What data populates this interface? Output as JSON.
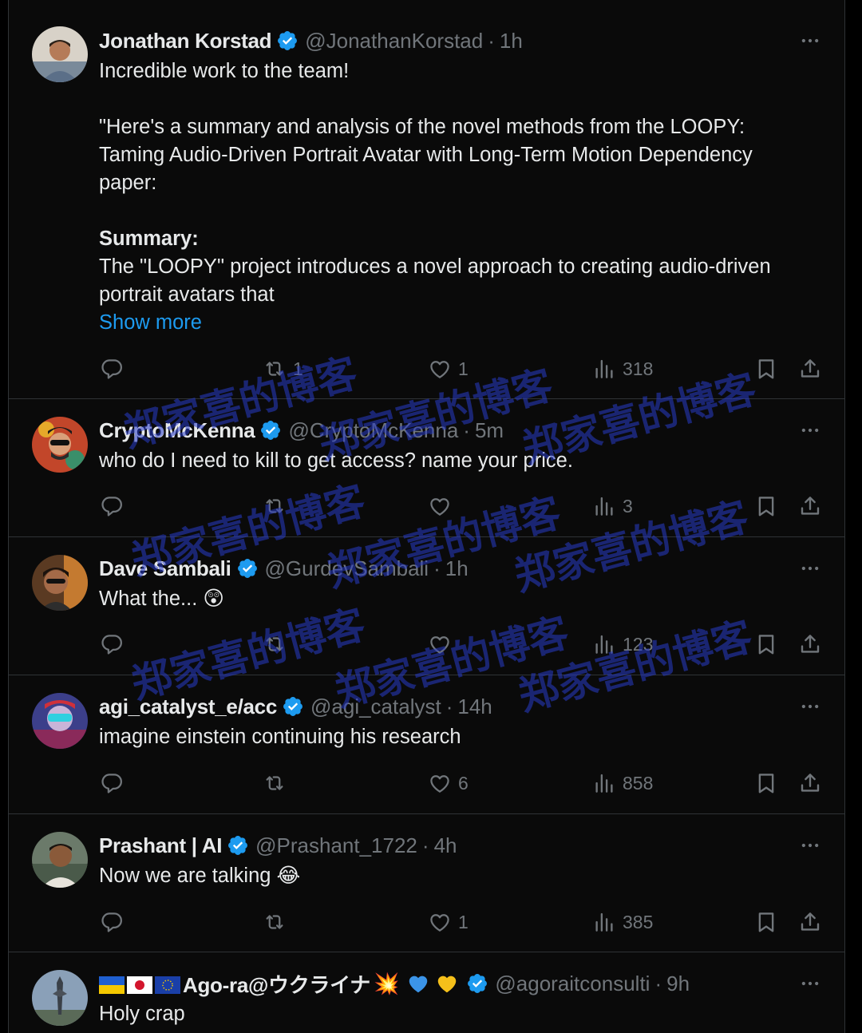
{
  "tweets": [
    {
      "name": "Jonathan Korstad",
      "handle": "@JonathanKorstad",
      "separator": "·",
      "time": "1h",
      "lines": [
        "Incredible work to the team!",
        "",
        "\"Here's a summary and analysis of the novel methods from the LOOPY:",
        "Taming Audio-Driven Portrait Avatar with Long-Term Motion Dependency",
        "paper:",
        "",
        "Summary:",
        "The \"LOOPY\" project introduces a novel approach to creating audio-driven",
        "portrait avatars that"
      ],
      "show_more": "Show more",
      "retweets": "1",
      "likes": "1",
      "views": "318"
    },
    {
      "name": "CryptoMcKenna",
      "handle": "@CryptoMcKenna",
      "separator": "·",
      "time": "5m",
      "text": "who do I need to kill to get access? name your price.",
      "retweets": "",
      "likes": "",
      "views": "3"
    },
    {
      "name": "Dave Sambali",
      "handle": "@GurdevSambali",
      "separator": "·",
      "time": "1h",
      "text": "What the...",
      "emoji": "😲",
      "retweets": "",
      "likes": "",
      "views": "123"
    },
    {
      "name": "agi_catalyst_e/acc",
      "handle": "@agi_catalyst",
      "separator": "·",
      "time": "14h",
      "text": "imagine einstein continuing his research",
      "retweets": "",
      "likes": "6",
      "views": "858"
    },
    {
      "name": "Prashant | AI",
      "handle": "@Prashant_1722",
      "separator": "·",
      "time": "4h",
      "text": "Now we are talking",
      "emoji": "😂",
      "retweets": "",
      "likes": "1",
      "views": "385"
    },
    {
      "name": "Ago-ra@ウクライナ",
      "name_suffix_emoji": "💥",
      "handle": "@agoraitconsulti",
      "separator": "·",
      "time": "9h",
      "text": "Holy crap"
    }
  ],
  "watermark": "郑家喜的博客",
  "colors": {
    "accent": "#1d9bf0",
    "muted": "#71767b",
    "text": "#e7e9ea",
    "border": "#2f3336"
  }
}
